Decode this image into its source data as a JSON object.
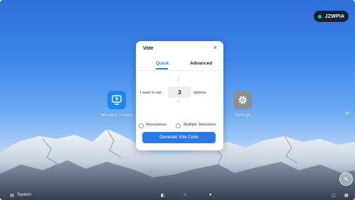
{
  "status": {
    "user_code": "JZWPIA",
    "online_color": "#2fd46b"
  },
  "desktop": {
    "apps": [
      {
        "label": "Wireless Screen",
        "icon": "screen-share-icon",
        "color": "#1e86f0"
      },
      {
        "label": "Settings",
        "icon": "gear-icon",
        "color": "#8a9096"
      }
    ],
    "side_arrow": "«"
  },
  "dialog": {
    "title": "Vote",
    "close": "×",
    "tabs": [
      {
        "label": "Quick"
      },
      {
        "label": "Advanced"
      }
    ],
    "active_tab": "Quick",
    "prefix": "I want to set",
    "count": "3",
    "suffix": "options",
    "stepper_prev": "2",
    "stepper_next": "4",
    "anonymous_label": "Anonymous",
    "multiple_label": "Multiple Selections",
    "generate_label": "Generate Vote Code",
    "accent": "#2b79e8"
  },
  "taskbar": {
    "left_label": "System"
  }
}
